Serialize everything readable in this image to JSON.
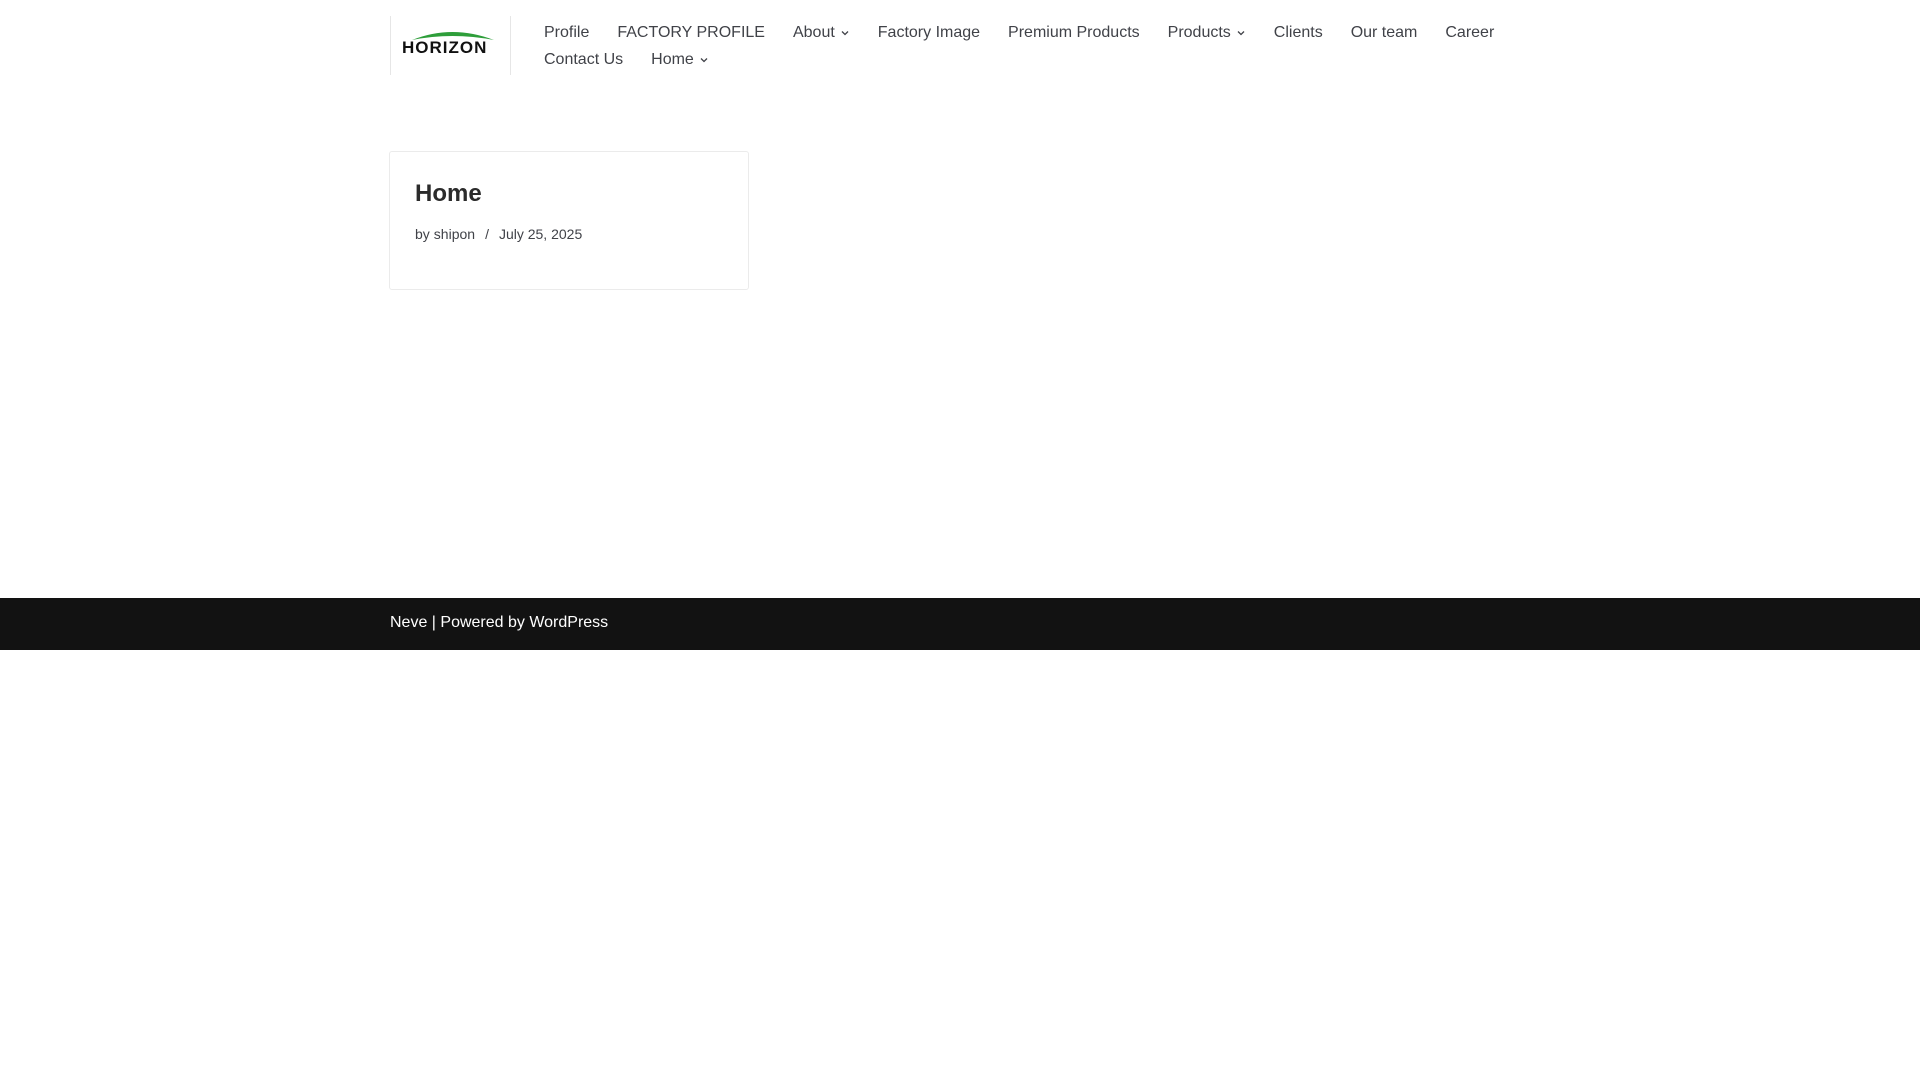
{
  "site": {
    "logo_text": "HORIZON",
    "logo_colors": {
      "arc": "#2e9e3a",
      "text": "#111111"
    }
  },
  "nav": {
    "row1": [
      {
        "label": "Profile",
        "has_dropdown": false
      },
      {
        "label": "FACTORY PROFILE",
        "has_dropdown": false
      },
      {
        "label": "About",
        "has_dropdown": true
      },
      {
        "label": "Factory Image",
        "has_dropdown": false
      },
      {
        "label": "Premium Products",
        "has_dropdown": false
      },
      {
        "label": "Products",
        "has_dropdown": true
      },
      {
        "label": "Clients",
        "has_dropdown": false
      },
      {
        "label": "Our team",
        "has_dropdown": false
      },
      {
        "label": "Career",
        "has_dropdown": false
      }
    ],
    "row2": [
      {
        "label": "Contact Us",
        "has_dropdown": false
      },
      {
        "label": "Home",
        "has_dropdown": true
      }
    ]
  },
  "post": {
    "title": "Home",
    "by": "by",
    "author": "shipon",
    "separator": "/",
    "date": "July 25, 2025"
  },
  "footer": {
    "theme_link": "Neve",
    "separator": " | Powered by ",
    "platform_link": "WordPress",
    "background": "#121212"
  }
}
